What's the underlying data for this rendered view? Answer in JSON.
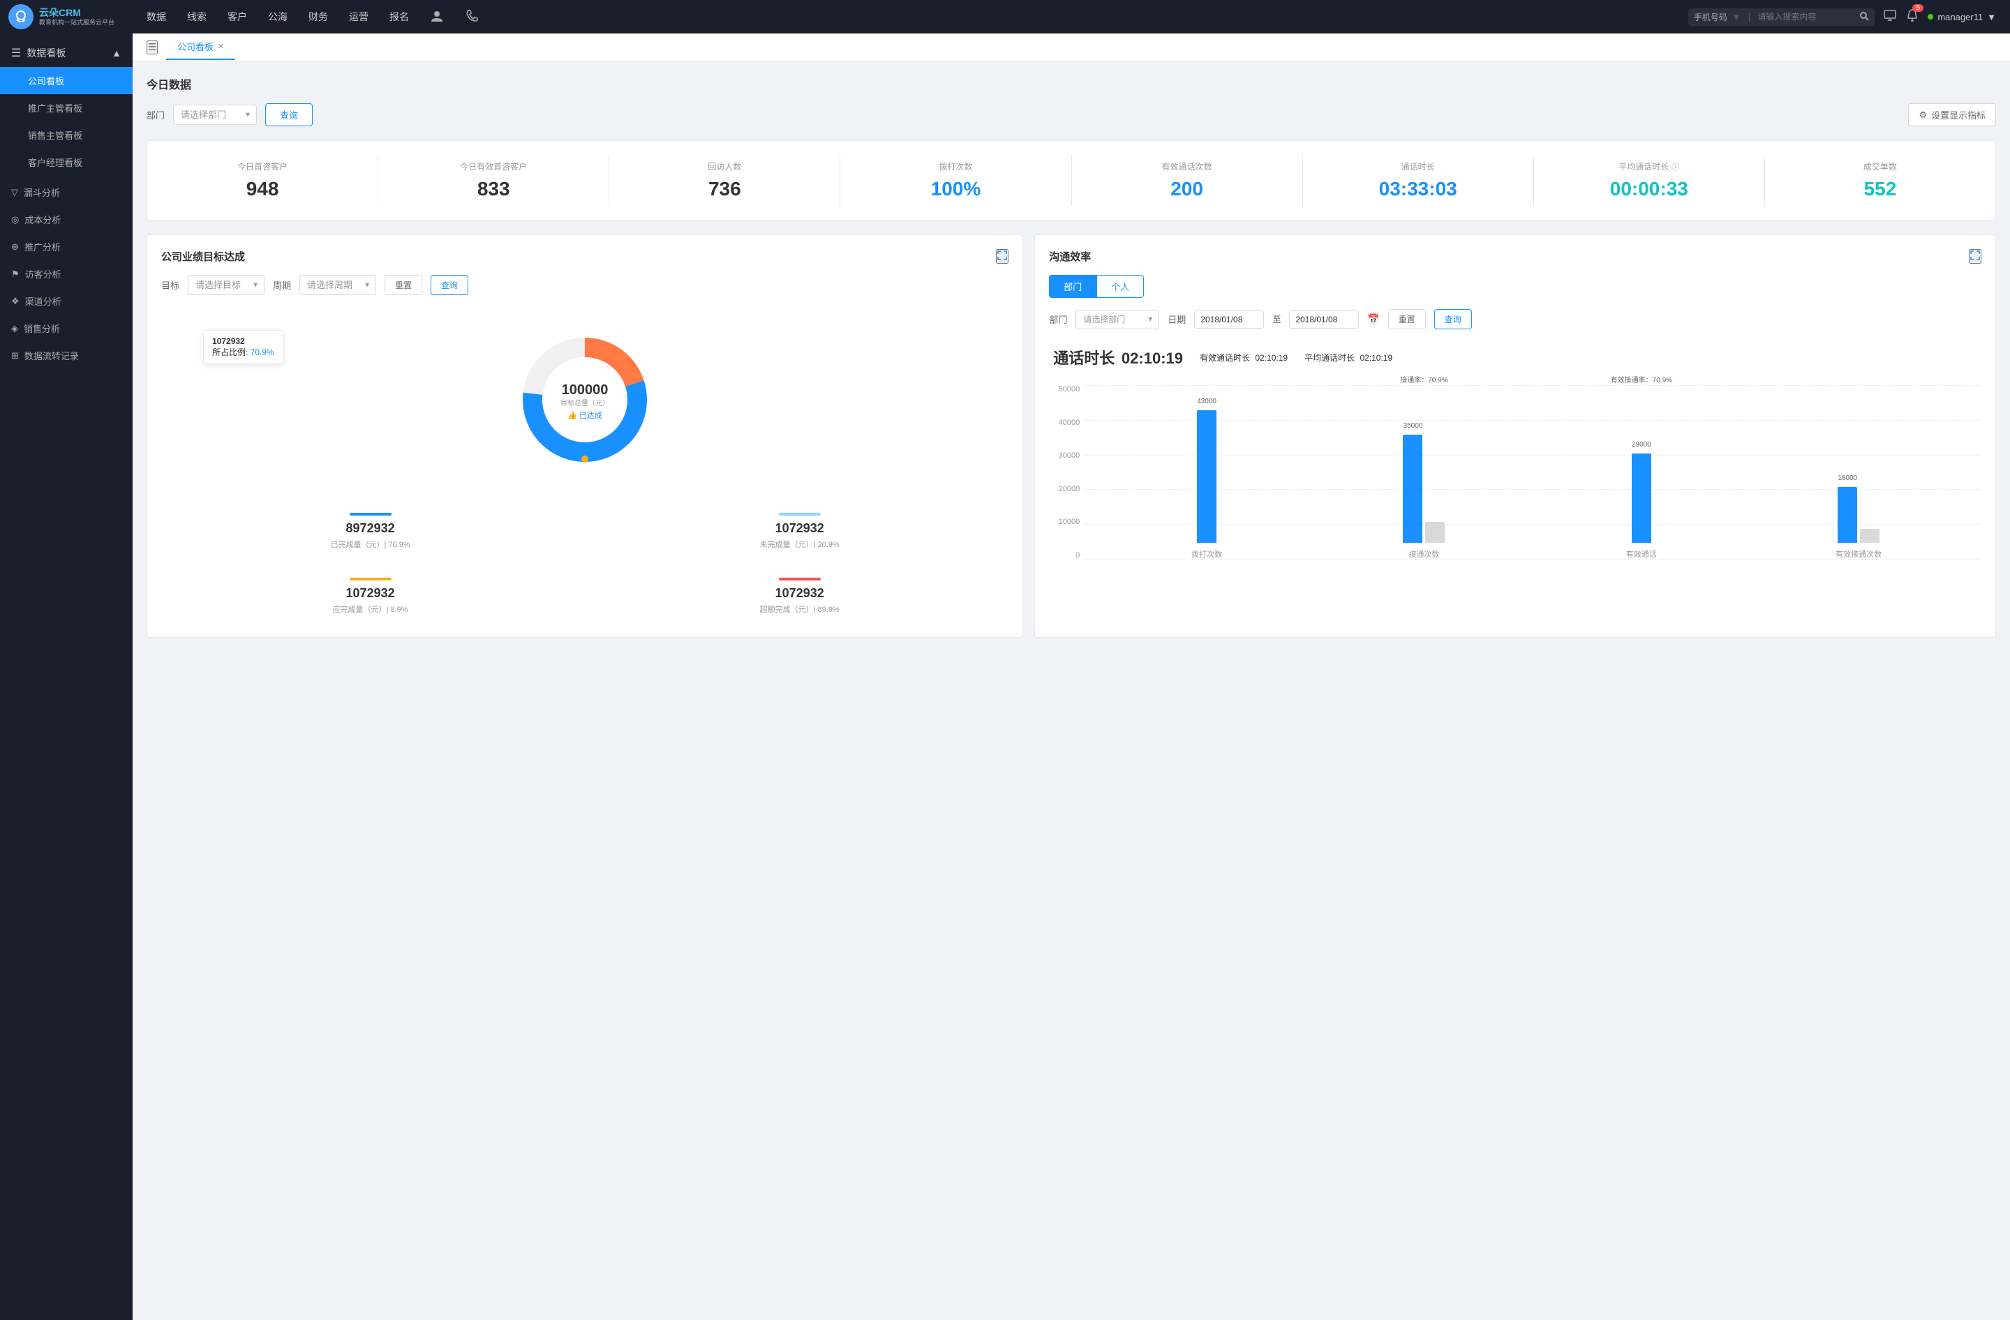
{
  "app": {
    "title": "云朵CRM",
    "subtitle": "教育机构一站式服务云平台"
  },
  "topNav": {
    "items": [
      "数据",
      "线索",
      "客户",
      "公海",
      "财务",
      "运营",
      "报名"
    ],
    "search": {
      "dropdown": "手机号码",
      "placeholder": "请输入搜索内容"
    },
    "badge": "5",
    "user": "manager11"
  },
  "sidebar": {
    "section1": {
      "label": "数据看板",
      "items": [
        "公司看板",
        "推广主管看板",
        "销售主管看板",
        "客户经理看板"
      ]
    },
    "section2": {
      "items": [
        {
          "label": "漏斗分析",
          "icon": "▽"
        },
        {
          "label": "成本分析",
          "icon": "◎"
        },
        {
          "label": "推广分析",
          "icon": "⊕"
        },
        {
          "label": "访客分析",
          "icon": "⚑"
        },
        {
          "label": "渠道分析",
          "icon": "❖"
        },
        {
          "label": "销售分析",
          "icon": "◈"
        },
        {
          "label": "数据流转记录",
          "icon": "⊞"
        }
      ]
    }
  },
  "tabs": [
    {
      "label": "公司看板",
      "active": true,
      "closeable": true
    }
  ],
  "page": {
    "title": "今日数据",
    "filter": {
      "dept_label": "部门",
      "dept_placeholder": "请选择部门",
      "query_btn": "查询",
      "settings_btn": "设置显示指标"
    },
    "stats": [
      {
        "label": "今日首咨客户",
        "value": "948",
        "color": "dark"
      },
      {
        "label": "今日有效首咨客户",
        "value": "833",
        "color": "dark"
      },
      {
        "label": "回访人数",
        "value": "736",
        "color": "dark"
      },
      {
        "label": "拨打次数",
        "value": "100%",
        "color": "blue"
      },
      {
        "label": "有效通话次数",
        "value": "200",
        "color": "blue"
      },
      {
        "label": "通话时长",
        "value": "03:33:03",
        "color": "blue"
      },
      {
        "label": "平均通话时长",
        "value": "00:00:33",
        "color": "cyan"
      },
      {
        "label": "成交单数",
        "value": "552",
        "color": "cyan"
      }
    ],
    "targetChart": {
      "title": "公司业绩目标达成",
      "filter": {
        "target_label": "目标",
        "target_placeholder": "请选择目标",
        "period_label": "周期",
        "period_placeholder": "请选择周期",
        "reset_btn": "重置",
        "query_btn": "查询"
      },
      "donut": {
        "total": "100000",
        "total_label": "目标总量（元）",
        "achieved_label": "已达成",
        "tooltip_value": "1072932",
        "tooltip_pct": "70.9%"
      },
      "stats": [
        {
          "color": "bar-blue",
          "value": "8972932",
          "label": "已完成量（元）| 70.9%"
        },
        {
          "color": "bar-lightblue",
          "value": "1072932",
          "label": "未完成量（元）| 20.9%"
        },
        {
          "color": "bar-orange",
          "value": "1072932",
          "label": "应完成量（元）| 8.9%"
        },
        {
          "color": "bar-red",
          "value": "1072932",
          "label": "超额完成（元）| 89.9%"
        }
      ]
    },
    "commChart": {
      "title": "沟通效率",
      "tabs": [
        "部门",
        "个人"
      ],
      "active_tab": "部门",
      "filter": {
        "dept_label": "部门",
        "dept_placeholder": "请选择部门",
        "date_from": "2018/01/08",
        "date_to": "2018/01/08",
        "reset_btn": "重置",
        "query_btn": "查询"
      },
      "stats": {
        "call_duration_label": "通话时长",
        "call_duration": "02:10:19",
        "effective_duration_label": "有效通话时长",
        "effective_duration": "02:10:19",
        "avg_duration_label": "平均通话时长",
        "avg_duration": "02:10:19"
      },
      "yAxis": [
        "50000",
        "40000",
        "30000",
        "20000",
        "10000",
        "0"
      ],
      "groups": [
        {
          "label": "拨打次数",
          "bar1_value": "43000",
          "bar1_height": 190,
          "bar2_value": "",
          "bar2_height": 0,
          "rate": ""
        },
        {
          "label": "接通次数",
          "bar1_value": "35000",
          "bar1_height": 155,
          "bar2_value": "",
          "bar2_height": 0,
          "rate": "接通率：70.9%"
        },
        {
          "label": "有效通话",
          "bar1_value": "29000",
          "bar1_height": 128,
          "bar2_value": "",
          "bar2_height": 0,
          "rate": "有效接通率：70.9%"
        },
        {
          "label": "有效接通次数",
          "bar1_value": "18000",
          "bar1_height": 80,
          "bar2_value": "",
          "bar2_height": 30,
          "rate": ""
        }
      ]
    }
  }
}
